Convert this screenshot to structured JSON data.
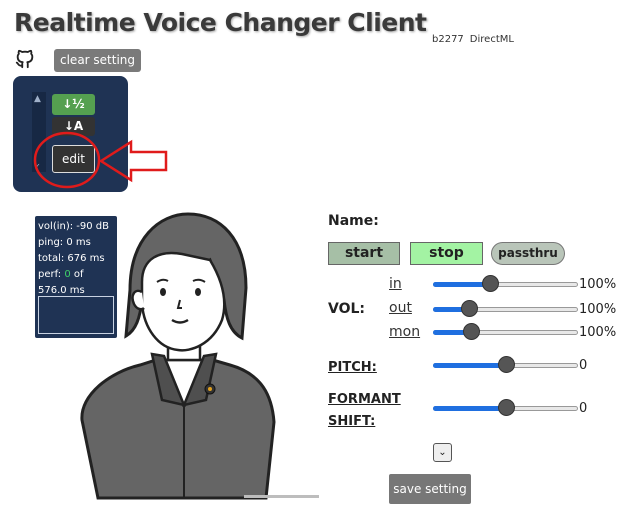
{
  "header": {
    "title": "Realtime Voice Changer Client",
    "version": "b2277",
    "backend": "DirectML",
    "clear_label": "clear setting"
  },
  "model_panel": {
    "edit_label": "edit",
    "sort_icon_1": "sort-numeric-down-icon",
    "sort_icon_2": "sort-alpha-down-icon"
  },
  "monitor": {
    "vol_in": "vol(in): -90 dB",
    "ping": "ping: 0 ms",
    "total": "total: 676 ms",
    "perf_prefix": "perf: ",
    "perf_value": "0",
    "perf_suffix": " of",
    "perf_total": "576.0 ms"
  },
  "controls": {
    "name_label": "Name:",
    "start_label": "start",
    "stop_label": "stop",
    "passthru_label": "passthru",
    "vol_label": "VOL:",
    "in_label": "in",
    "out_label": "out",
    "mon_label": "mon",
    "in_value": "100%",
    "out_value": "100%",
    "mon_value": "100%",
    "in_level": 0.39,
    "out_level": 0.25,
    "mon_level": 0.26,
    "pitch_label": "PITCH:",
    "pitch_value": "0",
    "pitch_level": 0.5,
    "formant_label_1": "FORMANT",
    "formant_label_2": "SHIFT:",
    "formant_value": "0",
    "formant_level": 0.5,
    "save_label": "save setting"
  },
  "colors": {
    "panel": "#1f3354",
    "accent": "#1f6fe0",
    "stop_active": "#a3f3a3",
    "annotation": "#e01b1b"
  }
}
